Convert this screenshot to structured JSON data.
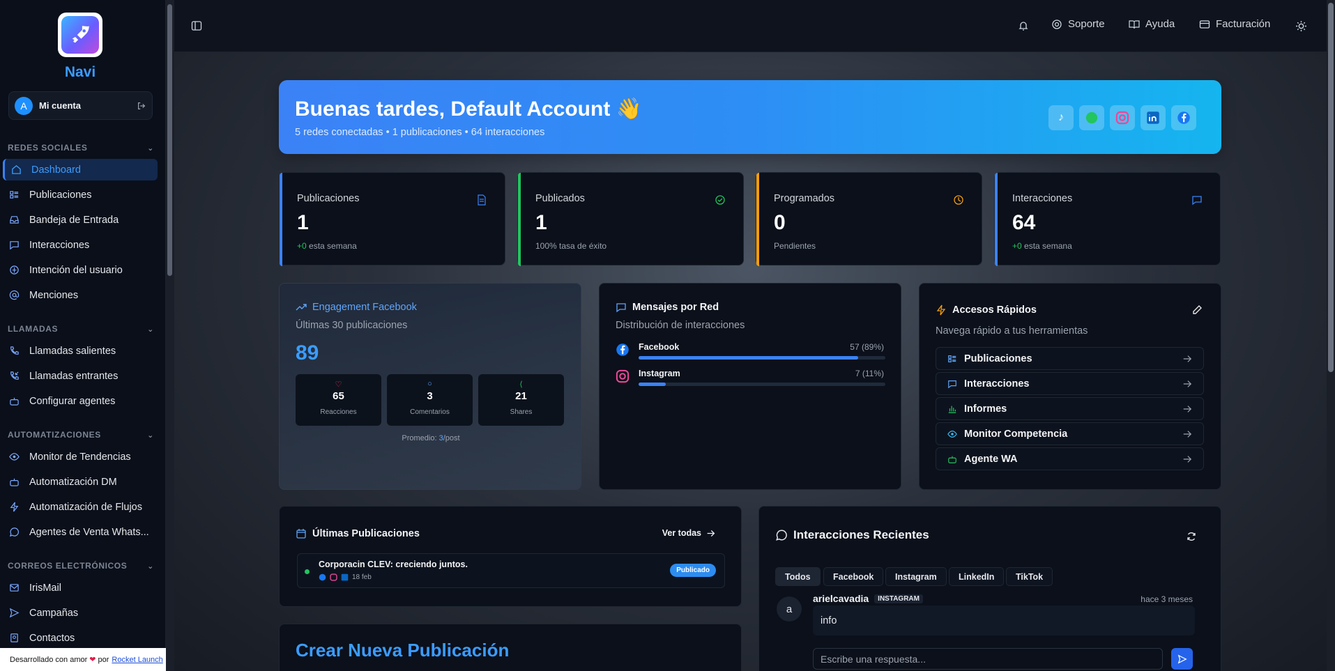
{
  "sidebar": {
    "brand": "Navi",
    "account": {
      "avatar_letter": "A",
      "label": "Mi cuenta"
    },
    "sections": [
      {
        "title": "REDES SOCIALES",
        "items": [
          "Dashboard",
          "Publicaciones",
          "Bandeja de Entrada",
          "Interacciones",
          "Intención del usuario",
          "Menciones"
        ]
      },
      {
        "title": "LLAMADAS",
        "items": [
          "Llamadas salientes",
          "Llamadas entrantes",
          "Configurar agentes"
        ]
      },
      {
        "title": "AUTOMATIZACIONES",
        "items": [
          "Monitor de Tendencias",
          "Automatización DM",
          "Automatización de Flujos",
          "Agentes de Venta Whats..."
        ]
      },
      {
        "title": "CORREOS ELECTRÓNICOS",
        "items": [
          "IrisMail",
          "Campañas",
          "Contactos"
        ]
      }
    ],
    "footer": {
      "text": "Desarrollado con amor",
      "by": "por",
      "link": "Rocket Launch"
    }
  },
  "topbar": {
    "actions": [
      "Soporte",
      "Ayuda",
      "Facturación"
    ]
  },
  "hero": {
    "greeting": "Buenas tardes, Default Account 👋",
    "summary": "5 redes conectadas • 1 publicaciones • 64 interacciones",
    "socials": [
      "TikTok",
      "WhatsApp",
      "Instagram",
      "LinkedIn",
      "Facebook"
    ]
  },
  "stats": [
    {
      "title": "Publicaciones",
      "value": "1",
      "delta": "+0",
      "note": "esta semana",
      "accent": "#3b82f6"
    },
    {
      "title": "Publicados",
      "value": "1",
      "note": "100% tasa de éxito",
      "accent": "#22c55e"
    },
    {
      "title": "Programados",
      "value": "0",
      "note": "Pendientes",
      "accent": "#f59e0b"
    },
    {
      "title": "Interacciones",
      "value": "64",
      "delta": "+0",
      "note": "esta semana",
      "accent": "#3b82f6"
    }
  ],
  "engagement": {
    "title": "Engagement Facebook",
    "subtitle": "Últimas 30 publicaciones",
    "total": "89",
    "metrics": [
      {
        "value": "65",
        "label": "Reacciones"
      },
      {
        "value": "3",
        "label": "Comentarios"
      },
      {
        "value": "21",
        "label": "Shares"
      }
    ],
    "average_label": "Promedio:",
    "average_value": "3",
    "average_unit": "/post"
  },
  "messages": {
    "title": "Mensajes por Red",
    "subtitle": "Distribución de interacciones",
    "rows": [
      {
        "network": "Facebook",
        "count": "57 (89%)",
        "fraction": 0.89
      },
      {
        "network": "Instagram",
        "count": "7 (11%)",
        "fraction": 0.11
      }
    ]
  },
  "quick_access": {
    "title": "Accesos Rápidos",
    "subtitle": "Navega rápido a tus herramientas",
    "items": [
      "Publicaciones",
      "Interacciones",
      "Informes",
      "Monitor Competencia",
      "Agente WA"
    ]
  },
  "latest_posts": {
    "title": "Últimas Publicaciones",
    "view_all": "Ver todas",
    "posts": [
      {
        "title": "Corporacin CLEV: creciendo juntos.",
        "date": "18 feb",
        "status": "Publicado"
      }
    ]
  },
  "create_post": {
    "title": "Crear Nueva Publicación"
  },
  "recent": {
    "title": "Interacciones Recientes",
    "filters": [
      "Todos",
      "Facebook",
      "Instagram",
      "LinkedIn",
      "TikTok"
    ],
    "item": {
      "avatar": "a",
      "user": "arielcavadia",
      "network": "INSTAGRAM",
      "time": "hace 3 meses",
      "message": "info"
    },
    "reply_placeholder": "Escribe una respuesta..."
  }
}
